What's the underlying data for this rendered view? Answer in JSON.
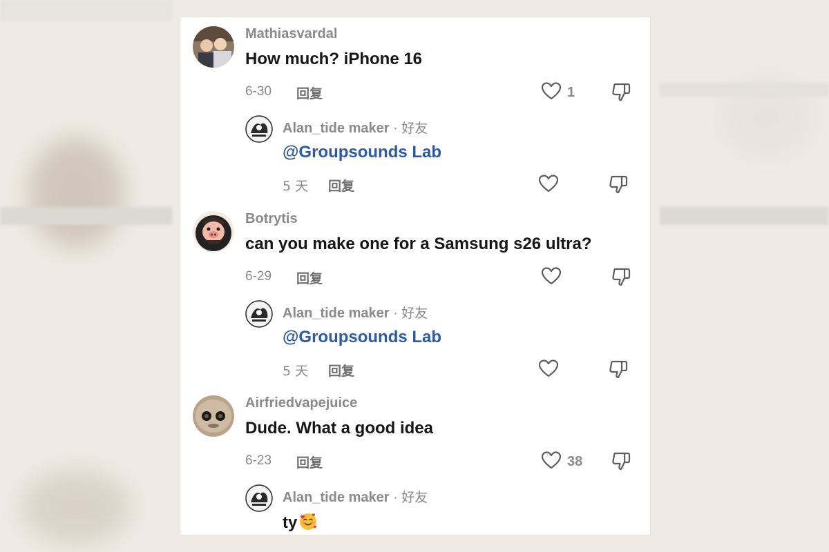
{
  "comments": [
    {
      "username": "Mathiasvardal",
      "text": "How much? iPhone 16",
      "date": "6-30",
      "reply_label": "回复",
      "likes": "1",
      "reply": {
        "username": "Alan_tide maker",
        "sep": " · ",
        "friend_label": "好友",
        "text": "@Groupsounds Lab",
        "date": "5 天",
        "reply_label": "回复"
      }
    },
    {
      "username": "Botrytis",
      "text": "can you make one for a Samsung s26 ultra?",
      "date": "6-29",
      "reply_label": "回复",
      "likes": "",
      "reply": {
        "username": "Alan_tide maker",
        "sep": " · ",
        "friend_label": "好友",
        "text": "@Groupsounds Lab",
        "date": "5 天",
        "reply_label": "回复"
      }
    },
    {
      "username": "Airfriedvapejuice",
      "text": "Dude. What a good idea",
      "date": "6-23",
      "reply_label": "回复",
      "likes": "38",
      "reply": {
        "username": "Alan_tide maker",
        "sep": " · ",
        "friend_label": "好友",
        "text": "ty",
        "emoji": "smiling-face-with-hearts-emoji"
      }
    }
  ],
  "colors": {
    "username": "#8a8a8a",
    "text": "#161616",
    "mention": "#2b5aa6",
    "meta": "#8a8a8a",
    "card_bg": "#ffffff",
    "page_bg": "#efebe4"
  },
  "icons": [
    "heart-outline-icon",
    "dislike-icon"
  ]
}
